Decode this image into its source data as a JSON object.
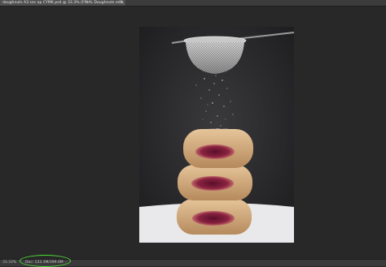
{
  "document_tab": {
    "title": "doughnuts A3 sec op CYMK.psd @ 33.3% (FINAL Doughnuts edit, CMYK/16)",
    "close": "×"
  },
  "canvas": {
    "image": "photo-of-stacked-jam-doughnuts-with-sieve-dusting-sugar"
  },
  "statusbar": {
    "zoom": "33.33%",
    "doc_info": "Doc: 133.3M/399.6M",
    "arrow": "›"
  },
  "colors": {
    "workspace": "#282828",
    "highlight": "#4ee039"
  }
}
